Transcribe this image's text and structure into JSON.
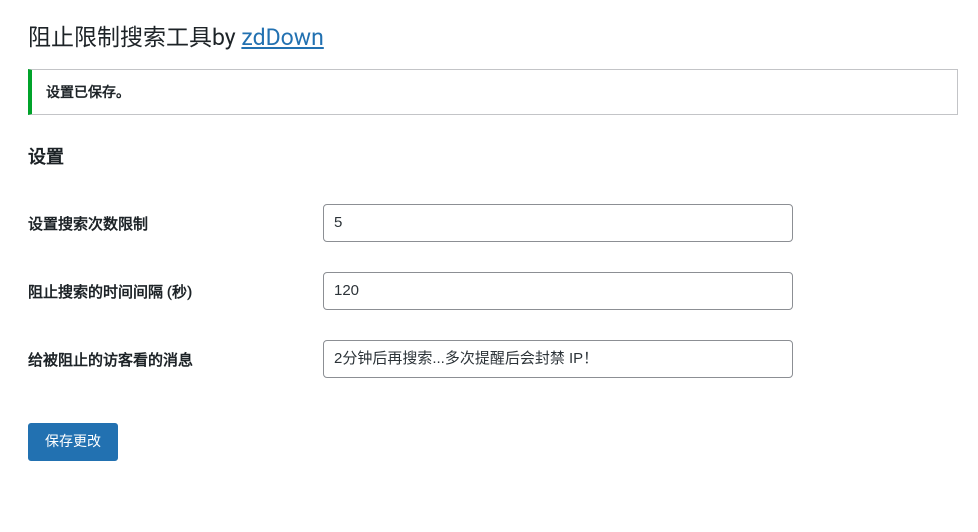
{
  "header": {
    "title_prefix": "阻止限制搜索工具by ",
    "title_link_text": "zdDown"
  },
  "notice": {
    "message": "设置已保存。"
  },
  "section": {
    "title": "设置"
  },
  "fields": {
    "search_limit": {
      "label": "设置搜索次数限制",
      "value": "5"
    },
    "block_interval": {
      "label": "阻止搜索的时间间隔 (秒)",
      "value": "120"
    },
    "blocked_message": {
      "label": "给被阻止的访客看的消息",
      "value": "2分钟后再搜索...多次提醒后会封禁 IP！"
    }
  },
  "actions": {
    "save_label": "保存更改"
  }
}
